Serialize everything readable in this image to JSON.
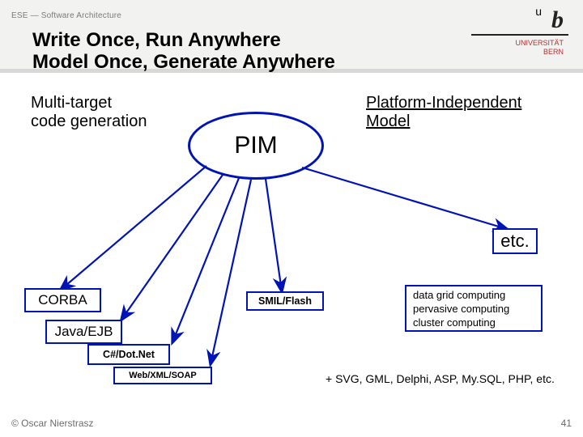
{
  "meta": {
    "course": "ESE — Software Architecture",
    "title_line1": "Write Once, Run Anywhere",
    "title_line2": "Model Once, Generate Anywhere",
    "university_line1": "UNIVERSITÄT",
    "university_line2": "BERN",
    "logo_symbol": "b",
    "logo_symbol_sup": "u"
  },
  "labels": {
    "sub_left_1": "Multi-target",
    "sub_left_2": "code generation",
    "sub_right_1": "Platform-Independent",
    "sub_right_2": "Model"
  },
  "diagram": {
    "center": "PIM",
    "targets": {
      "corba": "CORBA",
      "java_ejb": "Java/EJB",
      "csharp_dotnet": "C#/Dot.Net",
      "web_xml_soap": "Web/XML/SOAP",
      "smil_flash": "SMIL/Flash",
      "etc": "etc."
    },
    "expansion_1": "data grid computing",
    "expansion_2": "pervasive computing",
    "expansion_3": "cluster computing",
    "footnote": "+ SVG, GML, Delphi, ASP, My.SQL, PHP, etc."
  },
  "footer": {
    "copyright": "© Oscar Nierstrasz",
    "page": "41"
  },
  "colors": {
    "arrow": "#0013b7",
    "border": "#0013b7"
  }
}
